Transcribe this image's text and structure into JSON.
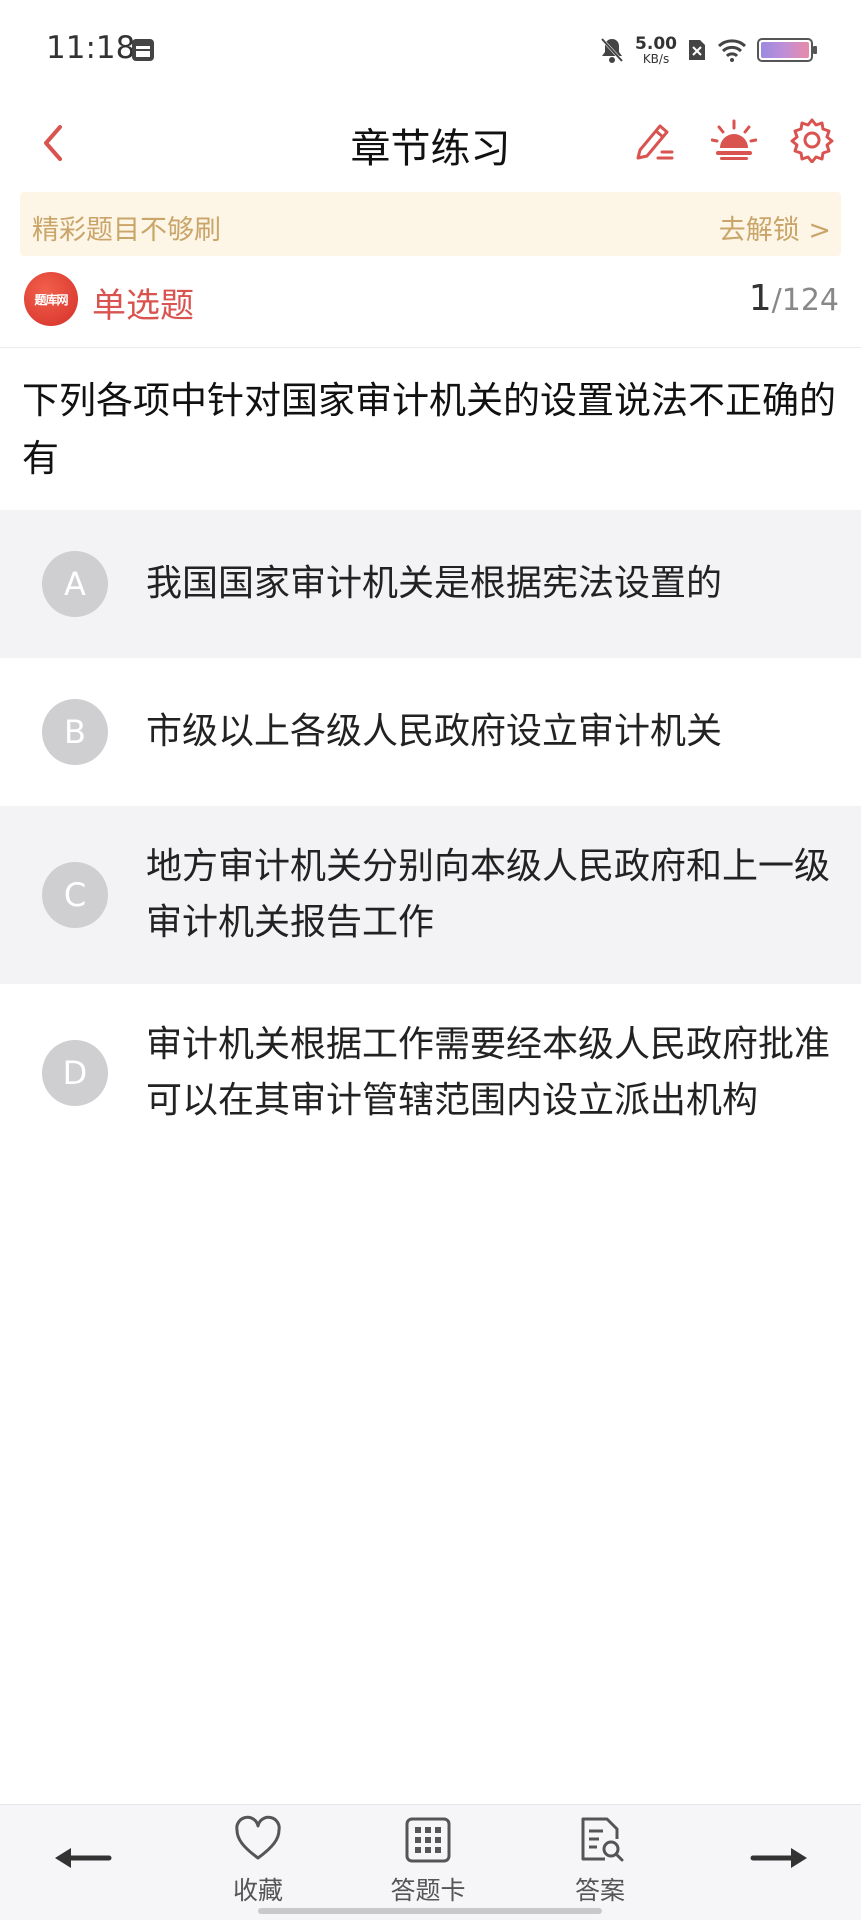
{
  "status_bar": {
    "time": "11:18",
    "net_speed": "5.00",
    "net_unit": "KB/s",
    "icons": [
      "calendar-app-icon",
      "bell-muted-icon",
      "sim-off-icon",
      "wifi-icon",
      "battery-icon"
    ]
  },
  "header": {
    "title": "章节练习",
    "accent": "#d9534f"
  },
  "banner": {
    "text": "精彩题目不够刷",
    "link": "去解锁 >"
  },
  "question_info": {
    "logo_text": "题库网",
    "type": "单选题",
    "current": "1",
    "total": "/124"
  },
  "question": {
    "text": "下列各项中针对国家审计机关的设置说法不正确的有"
  },
  "options": [
    {
      "letter": "A",
      "text": "我国国家审计机关是根据宪法设置的"
    },
    {
      "letter": "B",
      "text": "市级以上各级人民政府设立审计机关"
    },
    {
      "letter": "C",
      "text": "地方审计机关分别向本级人民政府和上一级审计机关报告工作"
    },
    {
      "letter": "D",
      "text": "审计机关根据工作需要经本级人民政府批准可以在其审计管辖范围内设立派出机构"
    }
  ],
  "bottom_bar": {
    "favorite": "收藏",
    "answer_card": "答题卡",
    "answer": "答案"
  }
}
